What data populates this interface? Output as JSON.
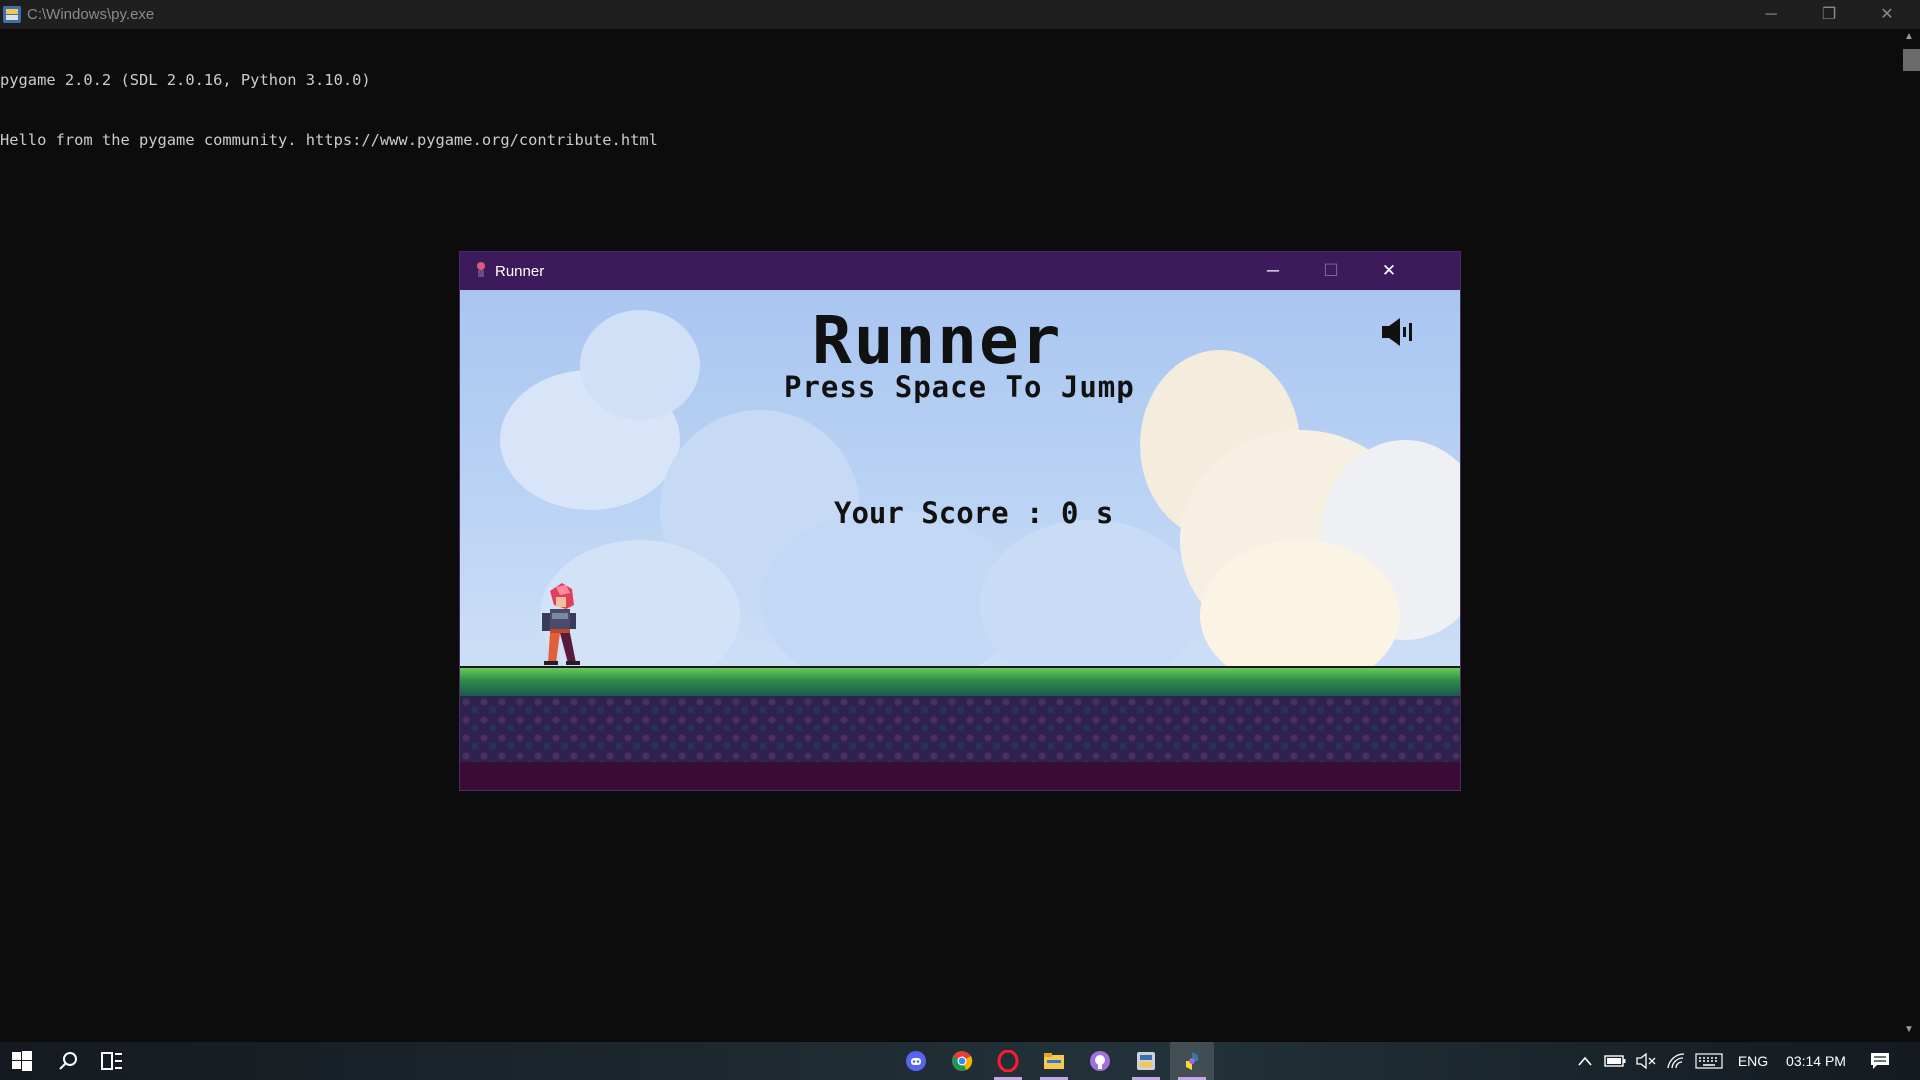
{
  "console": {
    "title": "C:\\Windows\\py.exe",
    "lines": [
      "pygame 2.0.2 (SDL 2.0.16, Python 3.10.0)",
      "Hello from the pygame community. https://www.pygame.org/contribute.html"
    ],
    "controls": {
      "minimize": "─",
      "restore": "❐",
      "close": "✕"
    }
  },
  "game_window": {
    "title": "Runner",
    "controls": {
      "minimize": "─",
      "maximize": "☐",
      "close": "✕"
    },
    "game_title": "Runner",
    "hint": "Press Space To Jump",
    "score_label": "Your Score : 0 s"
  },
  "taskbar": {
    "apps": [
      {
        "name": "discord",
        "icon": "discord-icon"
      },
      {
        "name": "chrome",
        "icon": "chrome-icon"
      },
      {
        "name": "opera",
        "icon": "opera-icon"
      },
      {
        "name": "file-explorer",
        "icon": "folder-icon"
      },
      {
        "name": "github",
        "icon": "github-icon"
      },
      {
        "name": "python-launcher",
        "icon": "python-launcher-icon"
      },
      {
        "name": "pygame",
        "icon": "pygame-icon"
      }
    ],
    "tray": {
      "language": "ENG",
      "time": "03:14 PM"
    }
  },
  "colors": {
    "console_bg": "#0c0c0c",
    "game_titlebar": "#3d1a5b",
    "sky": "#b2cdf2",
    "grass": "#4caf50",
    "bedrock": "#3a0c36"
  }
}
